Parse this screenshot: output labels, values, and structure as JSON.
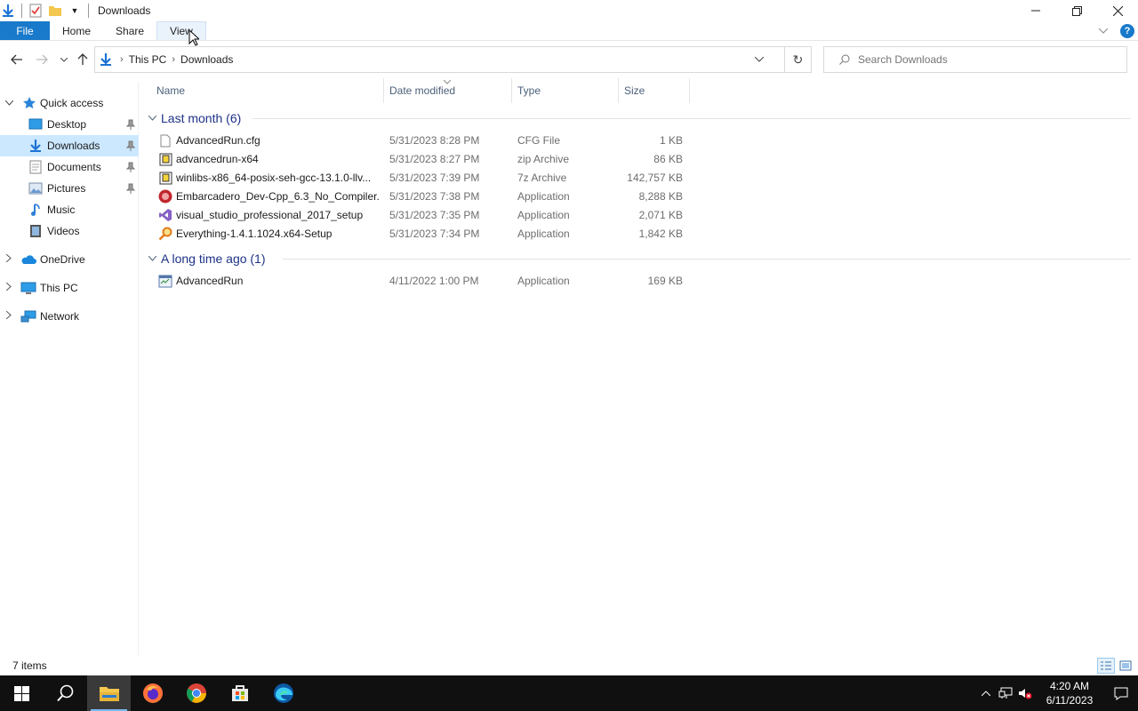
{
  "window": {
    "title": "Downloads",
    "controls": {
      "minimize_icon": "minimize-icon",
      "restore_icon": "restore-icon",
      "close_icon": "close-icon"
    }
  },
  "ribbon": {
    "tabs": [
      {
        "label": "File"
      },
      {
        "label": "Home"
      },
      {
        "label": "Share"
      },
      {
        "label": "View"
      }
    ],
    "help_label": "?"
  },
  "address": {
    "crumbs": [
      "This PC",
      "Downloads"
    ],
    "search_placeholder": "Search Downloads"
  },
  "sidebar": {
    "quick_access": {
      "label": "Quick access"
    },
    "items": [
      {
        "label": "Desktop",
        "icon": "desktop-icon",
        "pinned": true
      },
      {
        "label": "Downloads",
        "icon": "downloads-icon",
        "pinned": true,
        "selected": true
      },
      {
        "label": "Documents",
        "icon": "documents-icon",
        "pinned": true
      },
      {
        "label": "Pictures",
        "icon": "pictures-icon",
        "pinned": true
      },
      {
        "label": "Music",
        "icon": "music-icon",
        "pinned": false
      },
      {
        "label": "Videos",
        "icon": "videos-icon",
        "pinned": false
      }
    ],
    "roots": [
      {
        "label": "OneDrive",
        "icon": "onedrive-icon"
      },
      {
        "label": "This PC",
        "icon": "this-pc-icon"
      },
      {
        "label": "Network",
        "icon": "network-icon"
      }
    ]
  },
  "columns": [
    "Name",
    "Date modified",
    "Type",
    "Size"
  ],
  "groups": [
    {
      "label": "Last month (6)",
      "files": [
        {
          "name": "AdvancedRun.cfg",
          "date": "5/31/2023 8:28 PM",
          "type": "CFG File",
          "size": "1 KB",
          "icon": "cfg-file-icon"
        },
        {
          "name": "advancedrun-x64",
          "date": "5/31/2023 8:27 PM",
          "type": "zip Archive",
          "size": "86 KB",
          "icon": "zip-archive-icon"
        },
        {
          "name": "winlibs-x86_64-posix-seh-gcc-13.1.0-llv...",
          "date": "5/31/2023 7:39 PM",
          "type": "7z Archive",
          "size": "142,757 KB",
          "icon": "7z-archive-icon"
        },
        {
          "name": "Embarcadero_Dev-Cpp_6.3_No_Compiler...",
          "date": "5/31/2023 7:38 PM",
          "type": "Application",
          "size": "8,288 KB",
          "icon": "devcpp-icon"
        },
        {
          "name": "visual_studio_professional_2017_setup",
          "date": "5/31/2023 7:35 PM",
          "type": "Application",
          "size": "2,071 KB",
          "icon": "visual-studio-icon"
        },
        {
          "name": "Everything-1.4.1.1024.x64-Setup",
          "date": "5/31/2023 7:34 PM",
          "type": "Application",
          "size": "1,842 KB",
          "icon": "everything-search-icon"
        }
      ]
    },
    {
      "label": "A long time ago (1)",
      "files": [
        {
          "name": "AdvancedRun",
          "date": "4/11/2022 1:00 PM",
          "type": "Application",
          "size": "169 KB",
          "icon": "advancedrun-app-icon"
        }
      ]
    }
  ],
  "status": {
    "item_count": "7 items"
  },
  "taskbar": {
    "apps": [
      "start-icon",
      "search-icon",
      "file-explorer-icon",
      "firefox-icon",
      "chrome-icon",
      "store-icon",
      "edge-icon"
    ],
    "time": "4:20 AM",
    "date": "6/11/2023"
  }
}
